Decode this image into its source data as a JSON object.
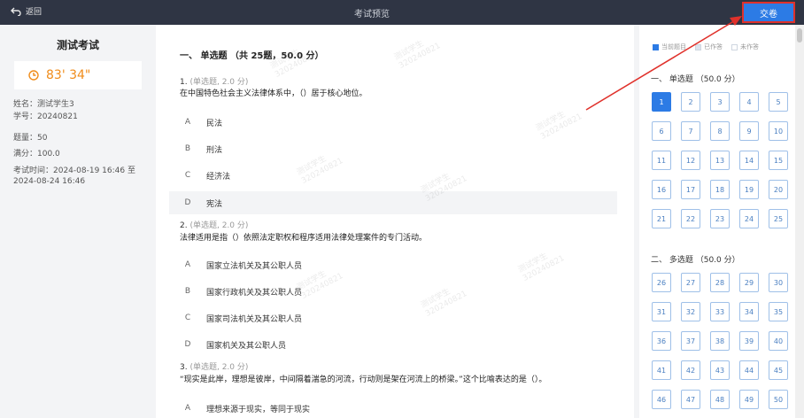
{
  "header": {
    "back_label": "返回",
    "title": "考试预览",
    "submit_label": "交卷"
  },
  "sidebar": {
    "exam_name": "测试考试",
    "timer": "83' 34\"",
    "name": "姓名：测试学生3",
    "student_id": "学号：20240821",
    "question_count": "题量：50",
    "full_score": "满分：100.0",
    "exam_time_line1": "考试时间：2024-08-19  16:46  至",
    "exam_time_line2": "2024-08-24  16:46"
  },
  "main": {
    "section_title": "一、 单选题 （共 25题，50.0 分）",
    "questions": [
      {
        "number": "1.",
        "meta": "(单选题, 2.0 分)",
        "text": "在中国特色社会主义法律体系中，（）居于核心地位。",
        "options": [
          {
            "letter": "A",
            "text": "民法"
          },
          {
            "letter": "B",
            "text": "刑法"
          },
          {
            "letter": "C",
            "text": "经济法"
          },
          {
            "letter": "D",
            "text": "宪法"
          }
        ]
      },
      {
        "number": "2.",
        "meta": "(单选题, 2.0 分)",
        "text": "法律适用是指（）依照法定职权和程序适用法律处理案件的专门活动。",
        "options": [
          {
            "letter": "A",
            "text": "国家立法机关及其公职人员"
          },
          {
            "letter": "B",
            "text": "国家行政机关及其公职人员"
          },
          {
            "letter": "C",
            "text": "国家司法机关及其公职人员"
          },
          {
            "letter": "D",
            "text": "国家机关及其公职人员"
          }
        ]
      },
      {
        "number": "3.",
        "meta": "(单选题, 2.0 分)",
        "text": "“现实是此岸，理想是彼岸，中间隔着湍急的河流，行动则是架在河流上的桥梁。”这个比喻表达的是（）。",
        "options": [
          {
            "letter": "A",
            "text": "理想来源于现实，等同于现实"
          }
        ]
      }
    ]
  },
  "answer_card": {
    "legend": [
      "当前题目",
      "已作答",
      "未作答"
    ],
    "sections": [
      {
        "label": "一、 单选题 （50.0 分）",
        "numbers": [
          "1",
          "2",
          "3",
          "4",
          "5",
          "6",
          "7",
          "8",
          "9",
          "10",
          "11",
          "12",
          "13",
          "14",
          "15",
          "16",
          "17",
          "18",
          "19",
          "20",
          "21",
          "22",
          "23",
          "24",
          "25"
        ]
      },
      {
        "label": "二、 多选题 （50.0 分）",
        "numbers": [
          "26",
          "27",
          "28",
          "29",
          "30",
          "31",
          "32",
          "33",
          "34",
          "35",
          "36",
          "37",
          "38",
          "39",
          "40",
          "41",
          "42",
          "43",
          "44",
          "45",
          "46",
          "47",
          "48",
          "49",
          "50"
        ]
      }
    ],
    "current": "1"
  },
  "watermark": {
    "line1": "测试学生",
    "line2": "320240821"
  },
  "colors": {
    "accent": "#2c7be5",
    "header_bg": "#2f3544",
    "timer": "#f08c1a",
    "annotation": "#e0312b"
  }
}
